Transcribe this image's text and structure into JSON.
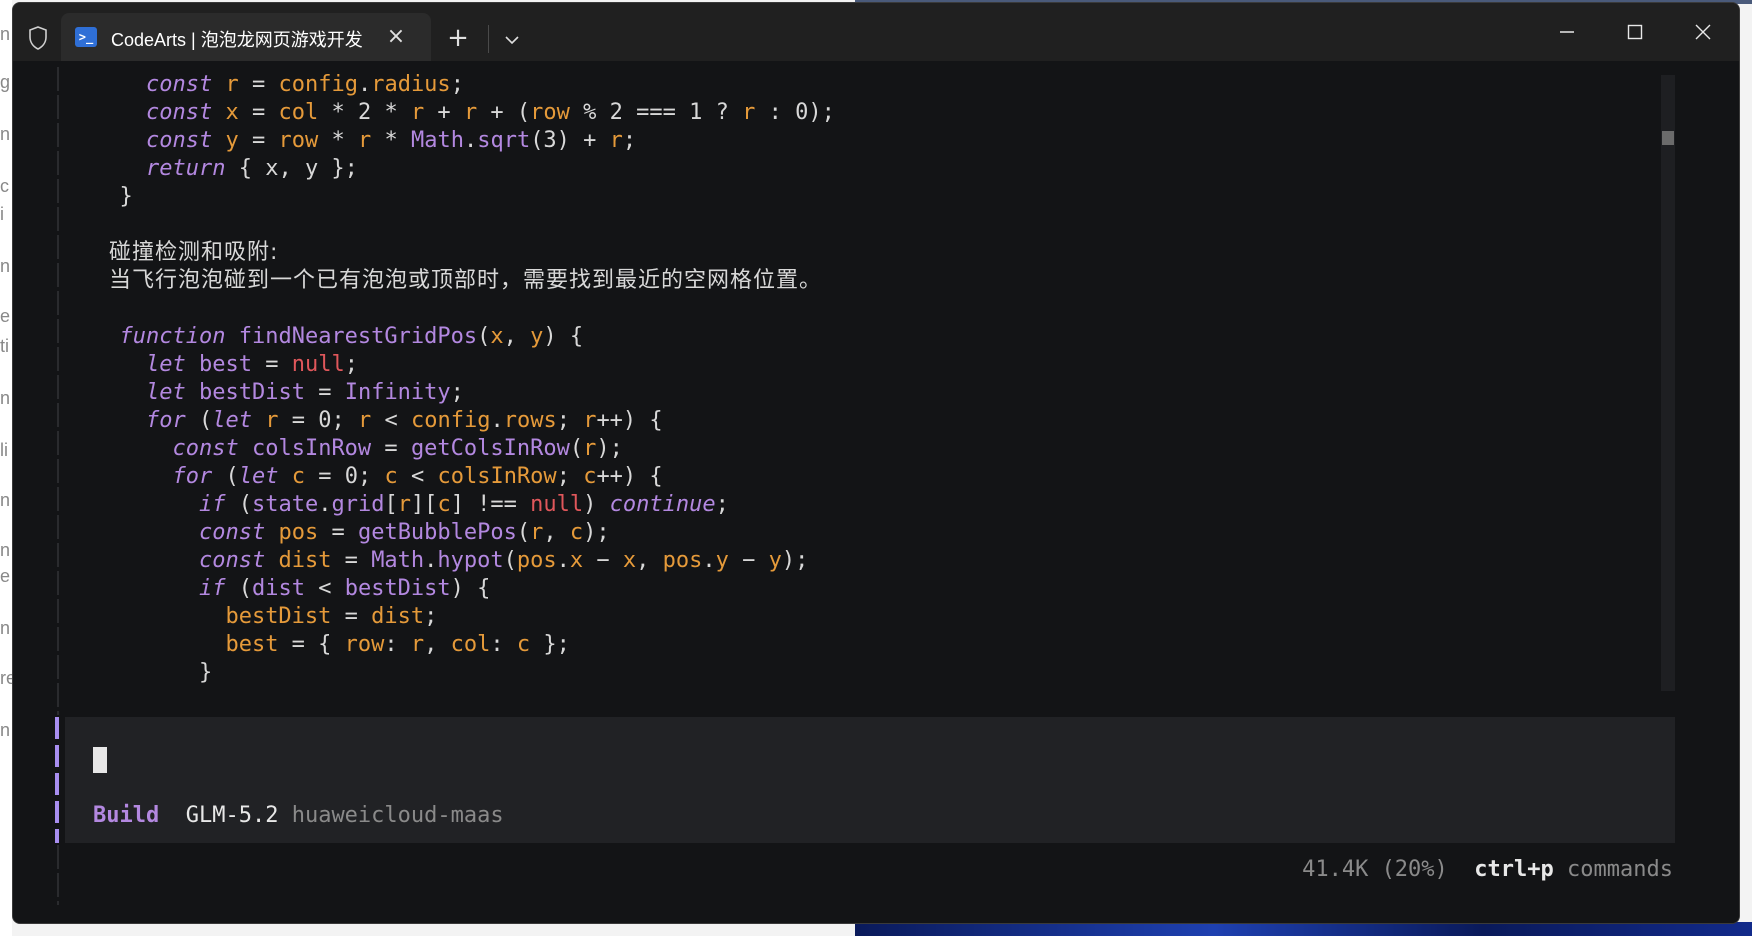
{
  "window": {
    "tab_title": "CodeArts | 泡泡龙网页游戏开发",
    "tab_icon": "powershell-icon"
  },
  "code_lines": [
    [
      [
        "    ",
        "plain"
      ],
      [
        "const",
        "kw"
      ],
      [
        " ",
        "plain"
      ],
      [
        "r",
        "var"
      ],
      [
        " = ",
        "plain"
      ],
      [
        "config",
        "var"
      ],
      [
        ".",
        "plain"
      ],
      [
        "radius",
        "var"
      ],
      [
        ";",
        "plain"
      ]
    ],
    [
      [
        "    ",
        "plain"
      ],
      [
        "const",
        "kw"
      ],
      [
        " ",
        "plain"
      ],
      [
        "x",
        "var"
      ],
      [
        " = ",
        "plain"
      ],
      [
        "col",
        "var"
      ],
      [
        " * 2 * ",
        "plain"
      ],
      [
        "r",
        "var"
      ],
      [
        " + ",
        "plain"
      ],
      [
        "r",
        "var"
      ],
      [
        " + (",
        "plain"
      ],
      [
        "row",
        "var"
      ],
      [
        " % 2 === 1 ? ",
        "plain"
      ],
      [
        "r",
        "var"
      ],
      [
        " : 0);",
        "plain"
      ]
    ],
    [
      [
        "    ",
        "plain"
      ],
      [
        "const",
        "kw"
      ],
      [
        " ",
        "plain"
      ],
      [
        "y",
        "var"
      ],
      [
        " = ",
        "plain"
      ],
      [
        "row",
        "var"
      ],
      [
        " * ",
        "plain"
      ],
      [
        "r",
        "var"
      ],
      [
        " * ",
        "plain"
      ],
      [
        "Math",
        "fn"
      ],
      [
        ".",
        "plain"
      ],
      [
        "sqrt",
        "fn"
      ],
      [
        "(3) + ",
        "plain"
      ],
      [
        "r",
        "var"
      ],
      [
        ";",
        "plain"
      ]
    ],
    [
      [
        "    ",
        "plain"
      ],
      [
        "return",
        "kw"
      ],
      [
        " { x, y };",
        "plain"
      ]
    ],
    [
      [
        "  }",
        "plain"
      ]
    ],
    [
      [
        "",
        "plain"
      ]
    ],
    [
      [
        "  碰撞检测和吸附:",
        "cjk"
      ]
    ],
    [
      [
        "  当飞行泡泡碰到一个已有泡泡或顶部时，需要找到最近的空网格位置。",
        "cjk"
      ]
    ],
    [
      [
        "",
        "plain"
      ]
    ],
    [
      [
        "  ",
        "plain"
      ],
      [
        "function",
        "kw"
      ],
      [
        " ",
        "plain"
      ],
      [
        "findNearestGridPos",
        "fn"
      ],
      [
        "(",
        "plain"
      ],
      [
        "x",
        "var"
      ],
      [
        ", ",
        "plain"
      ],
      [
        "y",
        "var"
      ],
      [
        ") {",
        "plain"
      ]
    ],
    [
      [
        "    ",
        "plain"
      ],
      [
        "let",
        "kw"
      ],
      [
        " ",
        "plain"
      ],
      [
        "best",
        "fn"
      ],
      [
        " = ",
        "plain"
      ],
      [
        "null",
        "nul"
      ],
      [
        ";",
        "plain"
      ]
    ],
    [
      [
        "    ",
        "plain"
      ],
      [
        "let",
        "kw"
      ],
      [
        " ",
        "plain"
      ],
      [
        "bestDist",
        "fn"
      ],
      [
        " = ",
        "plain"
      ],
      [
        "Infinity",
        "fn"
      ],
      [
        ";",
        "plain"
      ]
    ],
    [
      [
        "    ",
        "plain"
      ],
      [
        "for",
        "kw"
      ],
      [
        " (",
        "plain"
      ],
      [
        "let",
        "kw"
      ],
      [
        " ",
        "plain"
      ],
      [
        "r",
        "var"
      ],
      [
        " = 0; ",
        "plain"
      ],
      [
        "r",
        "var"
      ],
      [
        " < ",
        "plain"
      ],
      [
        "config",
        "var"
      ],
      [
        ".",
        "plain"
      ],
      [
        "rows",
        "var"
      ],
      [
        "; ",
        "plain"
      ],
      [
        "r",
        "var"
      ],
      [
        "++) {",
        "plain"
      ]
    ],
    [
      [
        "      ",
        "plain"
      ],
      [
        "const",
        "kw"
      ],
      [
        " ",
        "plain"
      ],
      [
        "colsInRow",
        "fn"
      ],
      [
        " = ",
        "plain"
      ],
      [
        "getColsInRow",
        "fn"
      ],
      [
        "(",
        "plain"
      ],
      [
        "r",
        "var"
      ],
      [
        ");",
        "plain"
      ]
    ],
    [
      [
        "      ",
        "plain"
      ],
      [
        "for",
        "kw"
      ],
      [
        " (",
        "plain"
      ],
      [
        "let",
        "kw"
      ],
      [
        " ",
        "plain"
      ],
      [
        "c",
        "var"
      ],
      [
        " = 0; ",
        "plain"
      ],
      [
        "c",
        "var"
      ],
      [
        " < ",
        "plain"
      ],
      [
        "colsInRow",
        "var"
      ],
      [
        "; ",
        "plain"
      ],
      [
        "c",
        "var"
      ],
      [
        "++) {",
        "plain"
      ]
    ],
    [
      [
        "        ",
        "plain"
      ],
      [
        "if",
        "kw"
      ],
      [
        " (",
        "plain"
      ],
      [
        "state",
        "fn"
      ],
      [
        ".",
        "plain"
      ],
      [
        "grid",
        "fn"
      ],
      [
        "[",
        "plain"
      ],
      [
        "r",
        "var"
      ],
      [
        "][",
        "plain"
      ],
      [
        "c",
        "var"
      ],
      [
        "] !== ",
        "plain"
      ],
      [
        "null",
        "nul"
      ],
      [
        ") ",
        "plain"
      ],
      [
        "continue",
        "kw"
      ],
      [
        ";",
        "plain"
      ]
    ],
    [
      [
        "        ",
        "plain"
      ],
      [
        "const",
        "kw"
      ],
      [
        " ",
        "plain"
      ],
      [
        "pos",
        "var"
      ],
      [
        " = ",
        "plain"
      ],
      [
        "getBubblePos",
        "fn"
      ],
      [
        "(",
        "plain"
      ],
      [
        "r",
        "var"
      ],
      [
        ", ",
        "plain"
      ],
      [
        "c",
        "var"
      ],
      [
        ");",
        "plain"
      ]
    ],
    [
      [
        "        ",
        "plain"
      ],
      [
        "const",
        "kw"
      ],
      [
        " ",
        "plain"
      ],
      [
        "dist",
        "var"
      ],
      [
        " = ",
        "plain"
      ],
      [
        "Math",
        "fn"
      ],
      [
        ".",
        "plain"
      ],
      [
        "hypot",
        "fn"
      ],
      [
        "(",
        "plain"
      ],
      [
        "pos",
        "var"
      ],
      [
        ".",
        "plain"
      ],
      [
        "x",
        "var"
      ],
      [
        " − ",
        "plain"
      ],
      [
        "x",
        "var"
      ],
      [
        ", ",
        "plain"
      ],
      [
        "pos",
        "var"
      ],
      [
        ".",
        "plain"
      ],
      [
        "y",
        "var"
      ],
      [
        " − ",
        "plain"
      ],
      [
        "y",
        "var"
      ],
      [
        ");",
        "plain"
      ]
    ],
    [
      [
        "        ",
        "plain"
      ],
      [
        "if",
        "kw"
      ],
      [
        " (",
        "plain"
      ],
      [
        "dist",
        "fn"
      ],
      [
        " < ",
        "plain"
      ],
      [
        "bestDist",
        "fn"
      ],
      [
        ") {",
        "plain"
      ]
    ],
    [
      [
        "          ",
        "plain"
      ],
      [
        "bestDist",
        "var"
      ],
      [
        " = ",
        "plain"
      ],
      [
        "dist",
        "var"
      ],
      [
        ";",
        "plain"
      ]
    ],
    [
      [
        "          ",
        "plain"
      ],
      [
        "best",
        "var"
      ],
      [
        " = { ",
        "plain"
      ],
      [
        "row",
        "var"
      ],
      [
        ": ",
        "plain"
      ],
      [
        "r",
        "var"
      ],
      [
        ", ",
        "plain"
      ],
      [
        "col",
        "var"
      ],
      [
        ": ",
        "plain"
      ],
      [
        "c",
        "var"
      ],
      [
        " };",
        "plain"
      ]
    ],
    [
      [
        "        }",
        "plain"
      ]
    ]
  ],
  "prompt": {
    "mode": "Build",
    "model": "GLM-5.2",
    "provider": "huaweicloud-maas"
  },
  "footer": {
    "tokens": "41.4K (20%)",
    "shortcut": "ctrl+p",
    "shortcut_label": "commands"
  },
  "colors": {
    "keyword": "#b388e0",
    "variable": "#e59a3a",
    "null": "#e0575b",
    "background": "#131416",
    "accent": "#a88ef0"
  }
}
